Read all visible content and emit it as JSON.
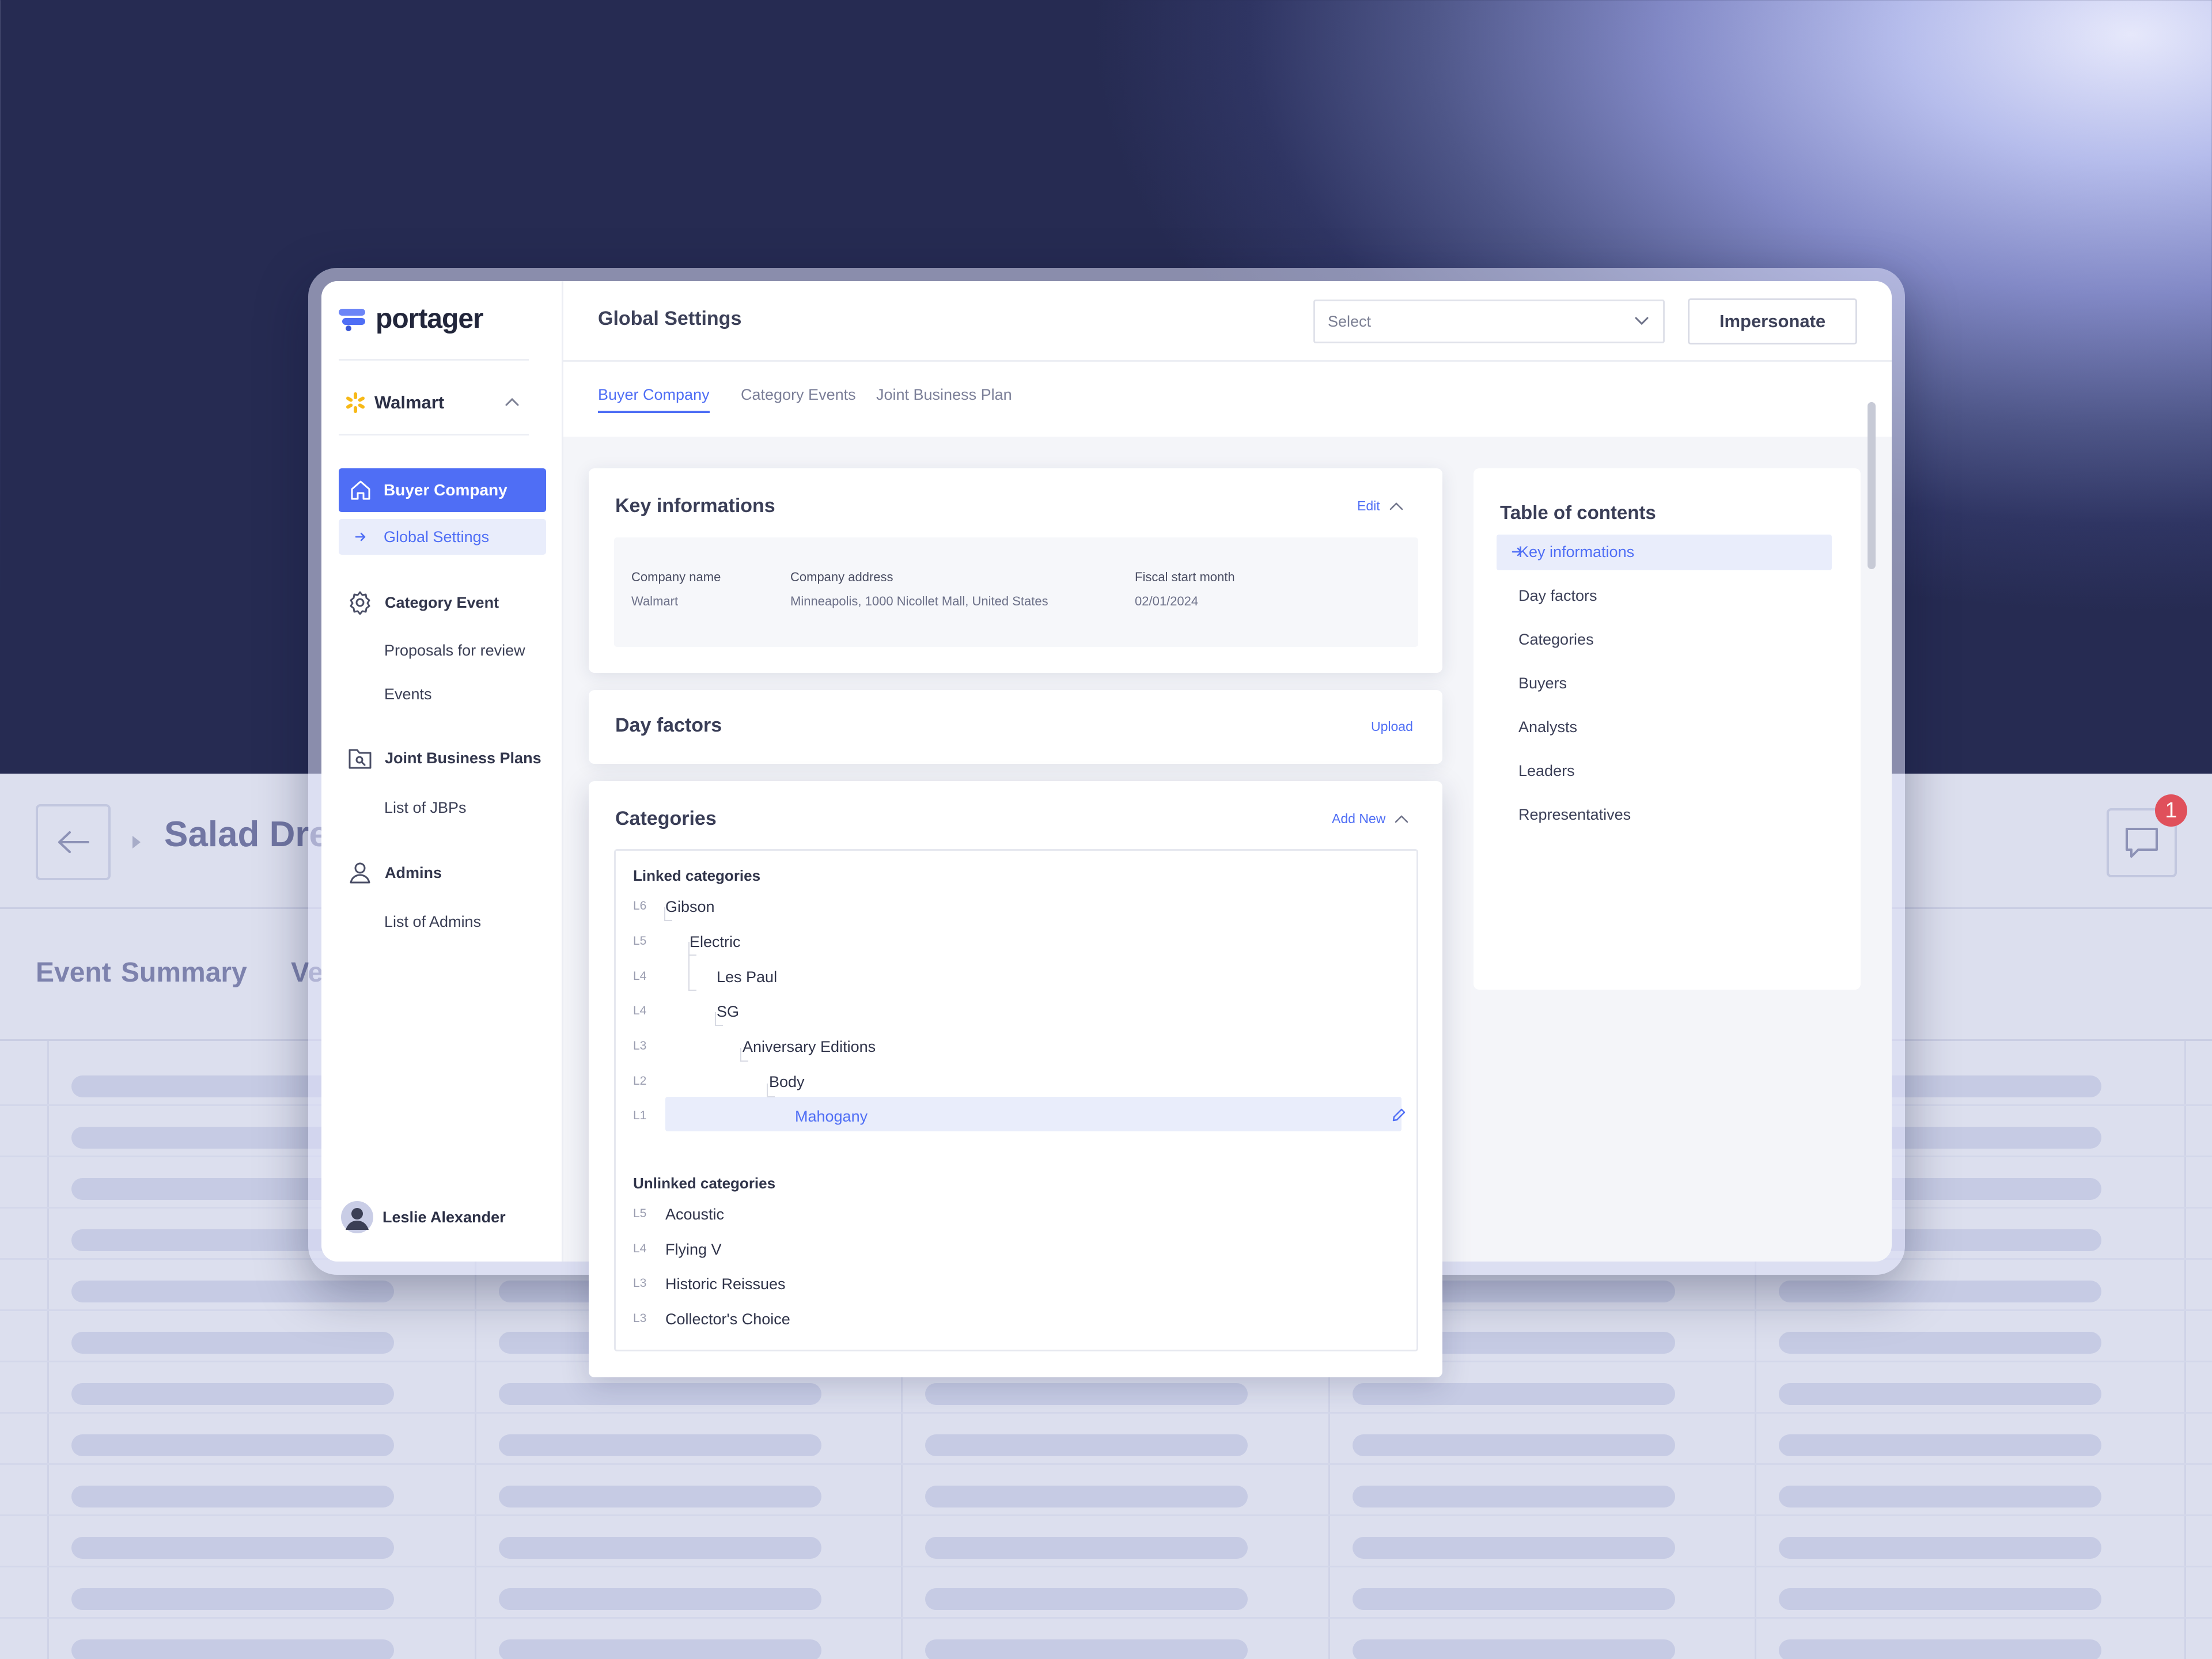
{
  "background_app": {
    "title": "Salad Dres",
    "notification_count": "1",
    "tabs": [
      "Event",
      "Summary",
      "Ve"
    ]
  },
  "brand": {
    "name": "portager"
  },
  "sidebar": {
    "company": "Walmart",
    "active_item": "Buyer Company",
    "active_sub": "Global Settings",
    "groups": [
      {
        "label": "Category Event",
        "items": [
          "Proposals for review",
          "Events"
        ]
      },
      {
        "label": "Joint Business Plans",
        "items": [
          "List of JBPs"
        ]
      },
      {
        "label": "Admins",
        "items": [
          "List of Admins"
        ]
      }
    ],
    "user": "Leslie Alexander"
  },
  "header": {
    "title": "Global Settings",
    "select_placeholder": "Select",
    "impersonate": "Impersonate"
  },
  "tabs": [
    {
      "label": "Buyer Company",
      "active": true
    },
    {
      "label": "Category Events",
      "active": false
    },
    {
      "label": "Joint Business Plan",
      "active": false
    }
  ],
  "key_info": {
    "title": "Key informations",
    "edit": "Edit",
    "fields": [
      {
        "label": "Company name",
        "value": "Walmart"
      },
      {
        "label": "Company address",
        "value": "Minneapolis, 1000 Nicollet Mall, United States"
      },
      {
        "label": "Fiscal start month",
        "value": "02/01/2024"
      }
    ]
  },
  "day_factors": {
    "title": "Day factors",
    "action": "Upload"
  },
  "categories": {
    "title": "Categories",
    "action": "Add New",
    "linked_title": "Linked categories",
    "linked": [
      {
        "level": "L6",
        "name": "Gibson"
      },
      {
        "level": "L5",
        "name": "Electric"
      },
      {
        "level": "L4",
        "name": "Les Paul"
      },
      {
        "level": "L4",
        "name": "SG"
      },
      {
        "level": "L3",
        "name": "Aniversary Editions"
      },
      {
        "level": "L2",
        "name": "Body"
      },
      {
        "level": "L1",
        "name": "Mahogany"
      }
    ],
    "unlinked_title": "Unlinked categories",
    "unlinked": [
      {
        "level": "L5",
        "name": "Acoustic"
      },
      {
        "level": "L4",
        "name": "Flying V"
      },
      {
        "level": "L3",
        "name": "Historic Reissues"
      },
      {
        "level": "L3",
        "name": "Collector's Choice"
      }
    ]
  },
  "toc": {
    "title": "Table of contents",
    "items": [
      "Key informations",
      "Day factors",
      "Categories",
      "Buyers",
      "Analysts",
      "Leaders",
      "Representatives"
    ],
    "active": "Key informations"
  },
  "colors": {
    "accent": "#4f6ef5",
    "walmart_spark": "#f7b917",
    "badge": "#e0505b"
  }
}
